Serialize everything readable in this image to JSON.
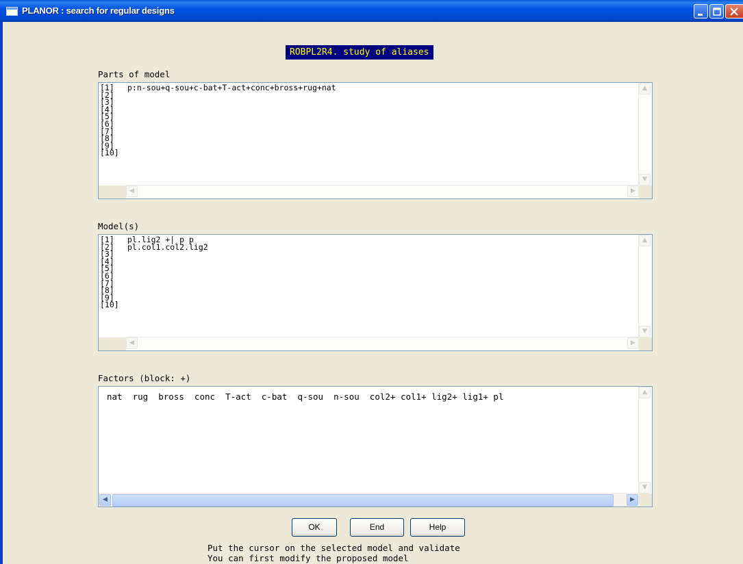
{
  "window": {
    "title": "PLANOR : search for regular designs",
    "controls": [
      "minimize-icon",
      "maximize-icon",
      "close-icon"
    ]
  },
  "banner": "ROBPL2R4. study of aliases",
  "parts_of_model": {
    "label": "Parts of model",
    "row_labels": [
      "[1]",
      "[2]",
      "[3]",
      "[4]",
      "[5]",
      "[6]",
      "[7]",
      "[8]",
      "[9]",
      "[10]"
    ],
    "lines": [
      "p:n-sou+q-sou+c-bat+T-act+conc+bross+rug+nat",
      "",
      "",
      "",
      "",
      "",
      "",
      "",
      "",
      ""
    ]
  },
  "models": {
    "label": "Model(s)",
    "row_labels": [
      "[1]",
      "[2]",
      "[3]",
      "[4]",
      "[5]",
      "[6]",
      "[7]",
      "[8]",
      "[9]",
      "[10]"
    ],
    "lines": [
      "pl.lig2 +| p p",
      "pl.col1.col2.lig2",
      "",
      "",
      "",
      "",
      "",
      "",
      "",
      ""
    ]
  },
  "factors": {
    "label": "Factors (block: +)",
    "line": "nat  rug  bross  conc  T-act  c-bat  q-sou  n-sou  col2+ col1+ lig2+ lig1+ pl"
  },
  "buttons": {
    "ok": "OK",
    "end": "End",
    "help": "Help"
  },
  "messages": {
    "line1": "Put the cursor on the selected model and validate",
    "line2": "You can first modify the proposed model"
  },
  "colors": {
    "banner_bg": "#000080",
    "banner_text": "#ffff00",
    "titlebar": "#0054e3",
    "window_bg": "#ece9d8"
  }
}
